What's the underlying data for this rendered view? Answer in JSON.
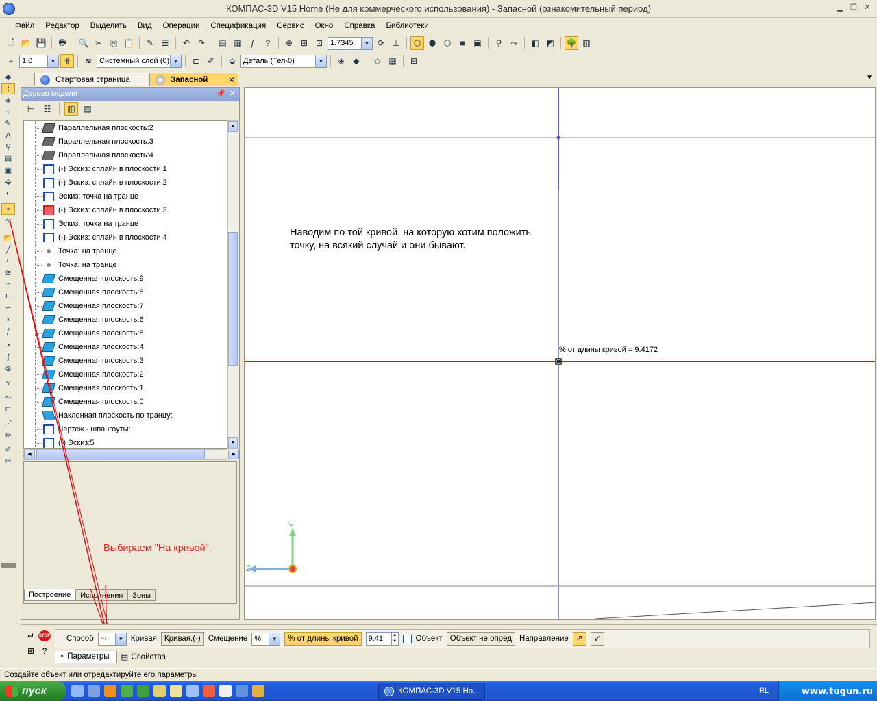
{
  "window": {
    "title": "КОМПАС-3D V15 Home (Не для коммерческого использования) - Запасной (ознакомительный период)"
  },
  "menu": [
    "Файл",
    "Редактор",
    "Выделить",
    "Вид",
    "Операции",
    "Спецификация",
    "Сервис",
    "Окно",
    "Справка",
    "Библиотеки"
  ],
  "toolbar": {
    "zoom_value": "1.7345",
    "step_value": "1.0",
    "layer_value": "Системный слой (0)",
    "detail_value": "Деталь (Тел-0)"
  },
  "doc_tabs": {
    "tab1": "Стартовая страница",
    "tab2": "Запасной",
    "close": "✕"
  },
  "tree": {
    "title": "Дерево модели",
    "items": [
      {
        "label": "Параллельная плоскость:2",
        "icon": "plane"
      },
      {
        "label": "Параллельная плоскость:3",
        "icon": "plane"
      },
      {
        "label": "Параллельная плоскость:4",
        "icon": "plane"
      },
      {
        "label": "(-) Эскиз: сплайн в плоскости 1",
        "icon": "sketch"
      },
      {
        "label": "(-) Эскиз: сплайн в плоскости 2",
        "icon": "sketch"
      },
      {
        "label": "Эскиз: точка на транце",
        "icon": "sketch"
      },
      {
        "label": "(-) Эскиз: сплайн в плоскости 3",
        "icon": "sketch-error"
      },
      {
        "label": "Эскиз: точка на транце",
        "icon": "sketch"
      },
      {
        "label": "(-) Эскиз: сплайн  в плоскости 4",
        "icon": "sketch"
      },
      {
        "label": "Точка: на транце",
        "icon": "point"
      },
      {
        "label": "Точка: на транце",
        "icon": "point"
      },
      {
        "label": "Смещенная плоскость:9",
        "icon": "offset"
      },
      {
        "label": "Смещенная плоскость:8",
        "icon": "offset"
      },
      {
        "label": "Смещенная плоскость:7",
        "icon": "offset"
      },
      {
        "label": "Смещенная плоскость:6",
        "icon": "offset"
      },
      {
        "label": "Смещенная плоскость:5",
        "icon": "offset"
      },
      {
        "label": "Смещенная плоскость:4",
        "icon": "offset"
      },
      {
        "label": "Смещенная плоскость:3",
        "icon": "offset"
      },
      {
        "label": "Смещенная плоскость:2",
        "icon": "offset"
      },
      {
        "label": "Смещенная плоскость:1",
        "icon": "offset"
      },
      {
        "label": "Смещенная плоскость:0",
        "icon": "offset"
      },
      {
        "label": "Наклонная плоскость по транцу:",
        "icon": "incline"
      },
      {
        "label": "Чертеж -  шпангоуты:",
        "icon": "sketch"
      },
      {
        "label": "(-) Эскиз:5",
        "icon": "sketch"
      }
    ],
    "tabs": [
      "Построение",
      "Исполнения",
      "Зоны"
    ]
  },
  "canvas": {
    "annotation_line1": "Наводим по той кривой, на которую хотим положить",
    "annotation_line2": "точку, на всякий случай и они бывают.",
    "param_label": "% от длины кривой = 9.4172",
    "axis_y": "Y",
    "axis_z": "Z"
  },
  "instruction": "Выбираем \"На кривой\".",
  "props": {
    "method_label": "Способ",
    "curve_label": "Кривая",
    "curve_value": "Кривая.(-)",
    "offset_label": "Смещение",
    "percent_button": "% от длины кривой",
    "percent_value": "9.41",
    "object_label": "Объект",
    "object_value": "Объект не опред",
    "direction_label": "Направление",
    "tab_params": "Параметры",
    "tab_props": "Свойства"
  },
  "status": "Создайте объект или отредактируйте его параметры",
  "taskbar": {
    "start": "пуск",
    "task": "КОМПАС-3D V15 Ho...",
    "lang": "RL",
    "watermark": "www.tugun.ru"
  },
  "colors": {
    "accent_yellow": "#ffd66b",
    "curve_red": "#e01010",
    "axis_blue": "#1a1aa8"
  }
}
